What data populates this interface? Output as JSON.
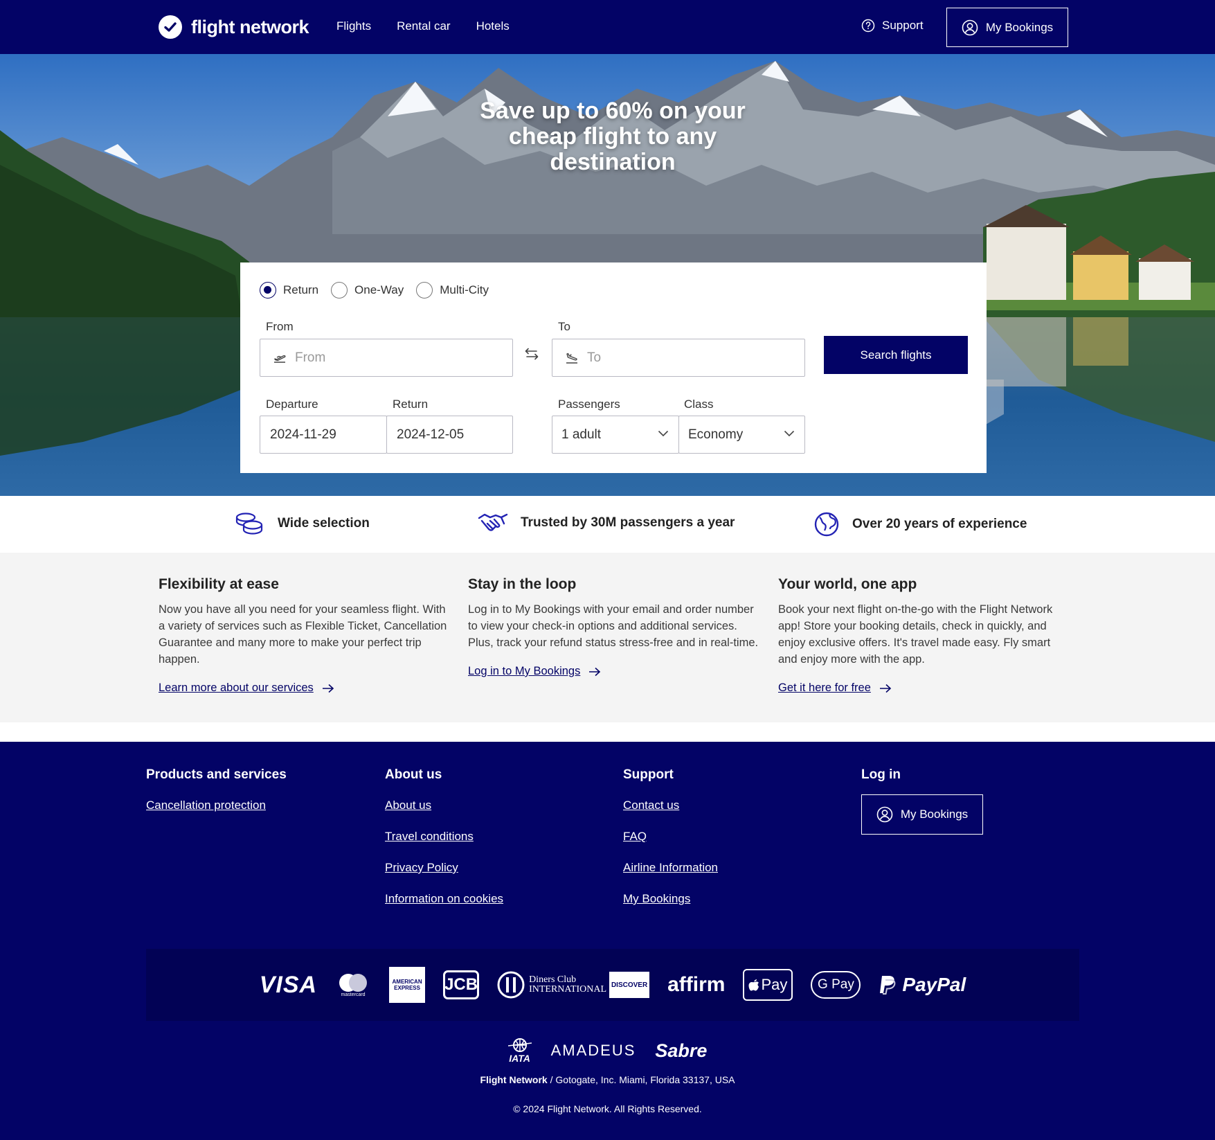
{
  "header": {
    "brand": "flight network",
    "nav": [
      "Flights",
      "Rental car",
      "Hotels"
    ],
    "support_label": "Support",
    "bookings_label": "My Bookings"
  },
  "hero": {
    "title": "Save up to 60% on your cheap flight to any destination"
  },
  "search": {
    "trip_types": [
      {
        "label": "Return",
        "selected": true
      },
      {
        "label": "One-Way",
        "selected": false
      },
      {
        "label": "Multi-City",
        "selected": false
      }
    ],
    "from_label": "From",
    "from_placeholder": "From",
    "to_label": "To",
    "to_placeholder": "To",
    "departure_label": "Departure",
    "departure_value": "2024-11-29",
    "return_label": "Return",
    "return_value": "2024-12-05",
    "passengers_label": "Passengers",
    "passengers_value": "1 adult",
    "class_label": "Class",
    "class_value": "Economy",
    "search_button": "Search flights"
  },
  "features": [
    "Wide selection",
    "Trusted by 30M passengers a year",
    "Over 20 years of experience"
  ],
  "info": [
    {
      "title": "Flexibility at ease",
      "body": "Now you have all you need for your seamless flight. With a variety of services such as Flexible Ticket, Cancellation Guarantee and many more to make your perfect trip happen.",
      "link": "Learn more about our services"
    },
    {
      "title": "Stay in the loop",
      "body": "Log in to My Bookings with your email and order number to view your check-in options and additional services. Plus, track your refund status stress-free and in real-time.",
      "link": "Log in to My Bookings"
    },
    {
      "title": "Your world, one app",
      "body": "Book your next flight on-the-go with the Flight Network app! Store your booking details, check in quickly, and enjoy exclusive offers. It's travel made easy. Fly smart and enjoy more with the app.",
      "link": "Get it here for free"
    }
  ],
  "footer": {
    "products": {
      "title": "Products and services",
      "links": [
        "Cancellation protection"
      ]
    },
    "about": {
      "title": "About us",
      "links": [
        "About us",
        "Travel conditions",
        "Privacy Policy",
        "Information on cookies"
      ]
    },
    "support": {
      "title": "Support",
      "links": [
        "Contact us",
        "FAQ",
        "Airline Information",
        "My Bookings"
      ]
    },
    "login": {
      "title": "Log in",
      "button": "My Bookings"
    },
    "payments": [
      "VISA",
      "mastercard",
      "AMERICAN EXPRESS",
      "JCB",
      "Diners Club INTERNATIONAL",
      "DISCOVER",
      "affirm",
      "Pay",
      "G Pay",
      "PayPal"
    ],
    "partners": [
      "IATA",
      "amadeus",
      "Sabre"
    ],
    "address_brand": "Flight Network",
    "address_rest": " / Gotogate, Inc. Miami, Florida 33137, USA",
    "copyright": "© 2024 Flight Network. All Rights Reserved."
  },
  "colors": {
    "brand": "#030366",
    "footer_payments": "#020255"
  }
}
